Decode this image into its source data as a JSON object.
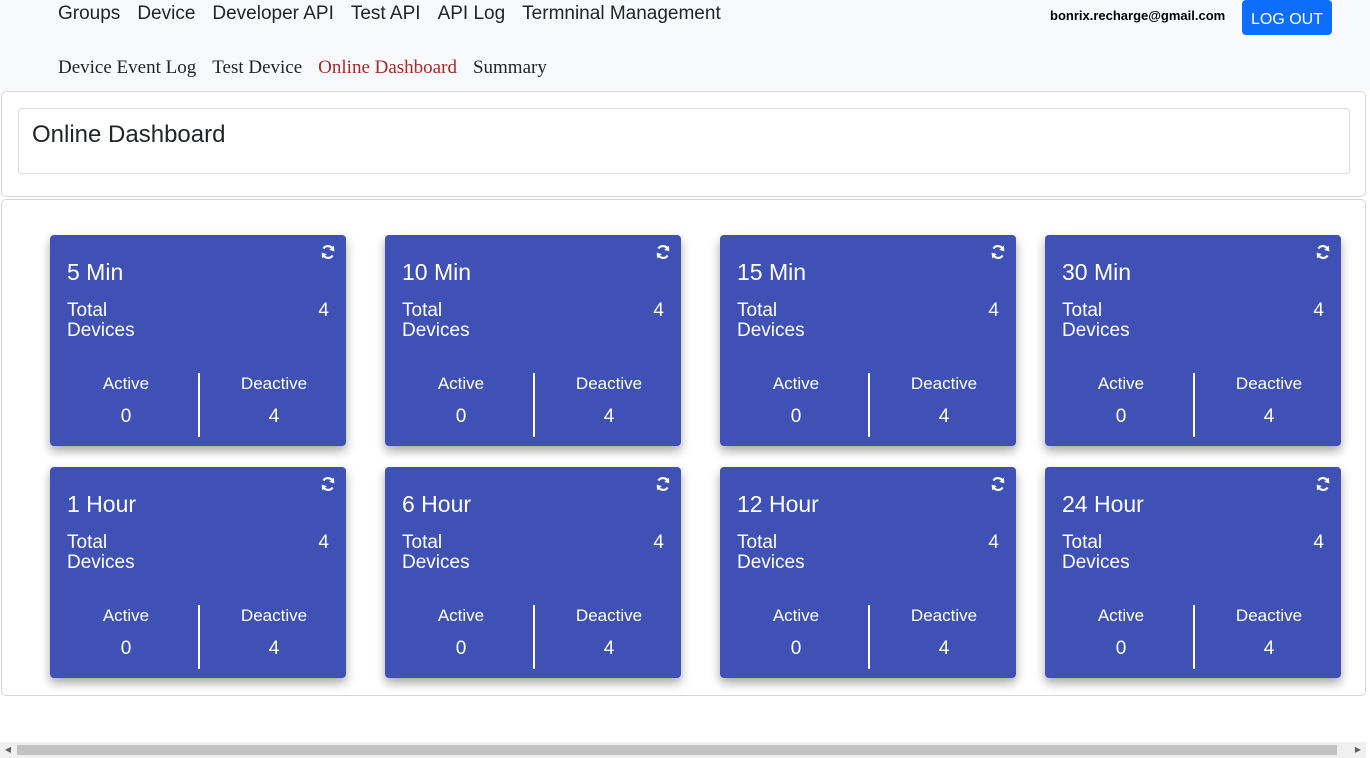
{
  "nav": {
    "primary": [
      "Groups",
      "Device",
      "Developer API",
      "Test API",
      "API Log",
      "Termninal Management"
    ],
    "secondary": [
      "Device Event Log",
      "Test Device",
      "Online Dashboard",
      "Summary"
    ],
    "active": "Online Dashboard"
  },
  "user": {
    "email": "bonrix.recharge@gmail.com",
    "logout_label": "LOG OUT"
  },
  "page": {
    "title": "Online Dashboard"
  },
  "labels": {
    "total_devices": "Total Devices",
    "active": "Active",
    "deactive": "Deactive"
  },
  "tiles": [
    {
      "period": "5 Min",
      "total": "4",
      "active": "0",
      "deactive": "4"
    },
    {
      "period": "10 Min",
      "total": "4",
      "active": "0",
      "deactive": "4"
    },
    {
      "period": "15 Min",
      "total": "4",
      "active": "0",
      "deactive": "4"
    },
    {
      "period": "30 Min",
      "total": "4",
      "active": "0",
      "deactive": "4"
    },
    {
      "period": "1 Hour",
      "total": "4",
      "active": "0",
      "deactive": "4"
    },
    {
      "period": "6 Hour",
      "total": "4",
      "active": "0",
      "deactive": "4"
    },
    {
      "period": "12 Hour",
      "total": "4",
      "active": "0",
      "deactive": "4"
    },
    {
      "period": "24 Hour",
      "total": "4",
      "active": "0",
      "deactive": "4"
    }
  ],
  "colors": {
    "tile_bg": "#3f51b5",
    "active_link": "#a52a2a",
    "logout_bg": "#0d6efd"
  },
  "icons": {
    "refresh": "refresh-icon"
  }
}
